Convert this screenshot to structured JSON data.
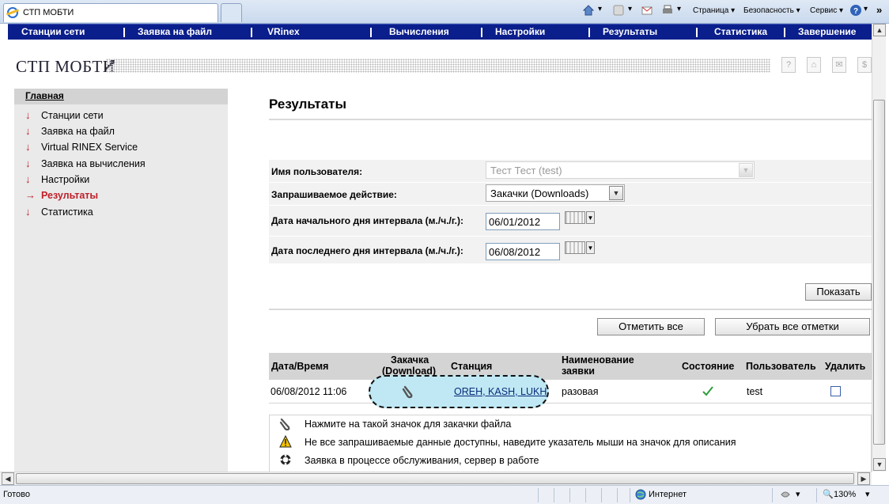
{
  "browser": {
    "tab_title": "СТП МОБТИ",
    "commands": {
      "page": "Страница",
      "security": "Безопасность",
      "service": "Сервис"
    }
  },
  "nav": {
    "items": [
      "Станции сети",
      "Заявка на файл",
      "VRinex",
      "Вычисления",
      "Настройки",
      "Результаты",
      "Статистика",
      "Завершение"
    ]
  },
  "logo": {
    "text": "СТП МОБТИ"
  },
  "utility_icons": [
    "help-icon",
    "home-icon",
    "mail-icon",
    "dollar-icon"
  ],
  "utility_glyphs": [
    "?",
    "⌂",
    "✉",
    "$"
  ],
  "sidebar": {
    "heading": "Главная",
    "items": [
      {
        "label": "Станции сети",
        "active": false
      },
      {
        "label": "Заявка на файл",
        "active": false
      },
      {
        "label": "Virtual RINEX Service",
        "active": false
      },
      {
        "label": "Заявка на вычисления",
        "active": false
      },
      {
        "label": "Настройки",
        "active": false
      },
      {
        "label": "Результаты",
        "active": true
      },
      {
        "label": "Статистика",
        "active": false
      }
    ]
  },
  "main": {
    "title": "Результаты",
    "form": {
      "user_label": "Имя пользователя:",
      "user_value": "Тест Тест (test)",
      "action_label": "Запрашиваемое действие:",
      "action_value": "Закачки (Downloads)",
      "start_label": "Дата начального дня интервала (м./ч./г.):",
      "start_value": "06/01/2012",
      "end_label": "Дата последнего дня интервала (м./ч./г.):",
      "end_value": "06/08/2012"
    },
    "show_button": "Показать",
    "mark_all_button": "Отметить все",
    "unmark_all_button": "Убрать все отметки",
    "table": {
      "headers": {
        "datetime": "Дата/Время",
        "download_1": "Закачка",
        "download_2": "(Download)",
        "station": "Станция",
        "name_1": "Наименование",
        "name_2": "заявки",
        "state": "Состояние",
        "user": "Пользователь",
        "delete": "Удалить"
      },
      "rows": [
        {
          "datetime": "06/08/2012 11:06",
          "station": "OREH, KASH, LUKH",
          "name": "разовая",
          "state_icon": "checkmark-icon",
          "user": "test",
          "delete_checked": false
        }
      ]
    },
    "legend": [
      {
        "icon": "paperclip-icon",
        "text": "Нажмите на такой значок для закачки файла"
      },
      {
        "icon": "warning-icon",
        "text": "Не все запрашиваемые данные доступны, наведите указатель мыши на значок для описания"
      },
      {
        "icon": "gear-icon",
        "text": "Заявка в процессе обслуживания, сервер в работе"
      }
    ]
  },
  "statusbar": {
    "left": "Готово",
    "zone": "Интернет",
    "zoom": "130%"
  },
  "colors": {
    "nav_bg": "#0a1e8c",
    "active_red": "#c0202a",
    "highlight": "#bfe8f4",
    "check_green": "#2a9d3a"
  }
}
